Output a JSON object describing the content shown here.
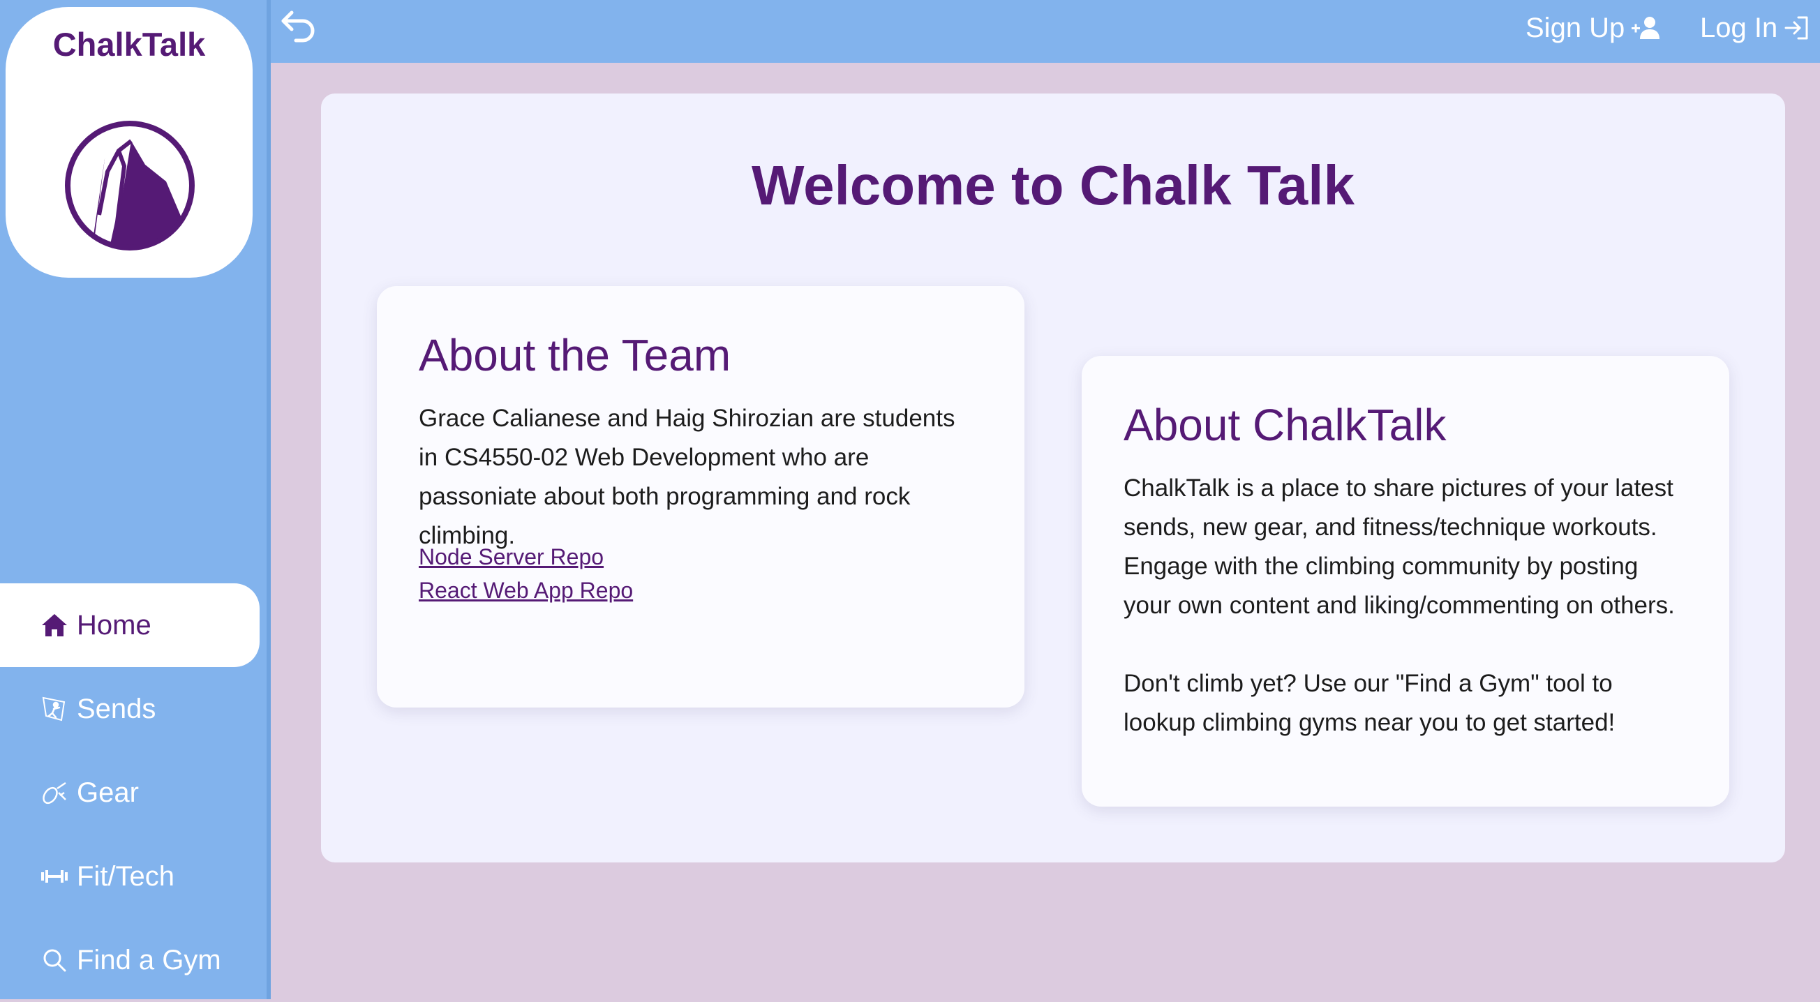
{
  "app": {
    "logo_text": "ChalkTalk"
  },
  "sidebar": {
    "items": [
      {
        "label": "Home",
        "icon": "home-icon",
        "active": true
      },
      {
        "label": "Sends",
        "icon": "climber-icon",
        "active": false
      },
      {
        "label": "Gear",
        "icon": "carabiner-icon",
        "active": false
      },
      {
        "label": "Fit/Tech",
        "icon": "dumbbell-icon",
        "active": false
      },
      {
        "label": "Find a Gym",
        "icon": "search-icon",
        "active": false
      }
    ]
  },
  "topbar": {
    "back_icon": "undo-arrow-icon",
    "signup_label": "Sign Up",
    "signup_icon": "add-user-icon",
    "login_label": "Log In",
    "login_icon": "login-arrow-icon"
  },
  "main": {
    "title": "Welcome to Chalk Talk",
    "team_card": {
      "heading": "About the Team",
      "body": "Grace Calianese and Haig Shirozian are students in CS4550-02 Web Development who are passoniate about both programming and rock climbing.",
      "link1": "Node Server Repo",
      "link2": "React Web App Repo"
    },
    "about_card": {
      "heading": "About ChalkTalk",
      "body1": "ChalkTalk is a place to share pictures of your latest sends, new gear, and fitness/technique workouts. Engage with the climbing community by posting your own content and liking/commenting on others.",
      "body2": "Don't climb yet? Use our \"Find a Gym\" tool to lookup climbing gyms near you to get started!"
    }
  },
  "colors": {
    "brand_purple": "#551a75",
    "sidebar_blue": "#82b3ed",
    "page_background": "#dccbdf",
    "panel_background": "#f1f1fe"
  }
}
